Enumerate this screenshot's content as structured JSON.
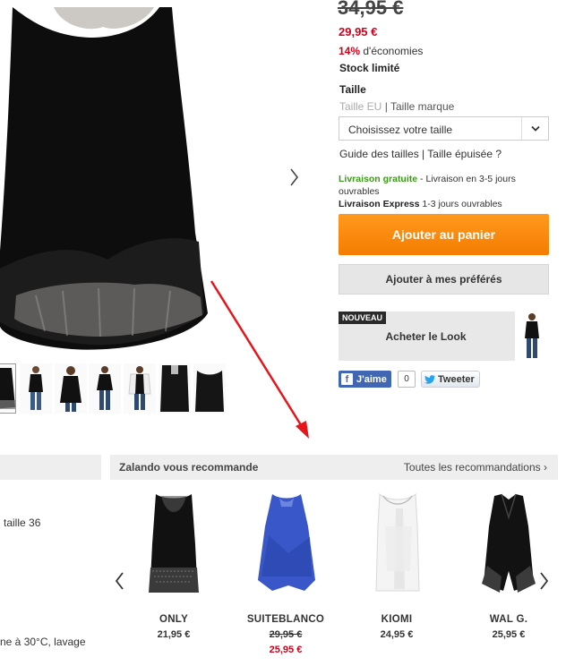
{
  "product": {
    "old_price": "34,95 €",
    "new_price": "29,95 €",
    "savings_pct": "14%",
    "savings_text": " d'économies",
    "stock": "Stock limité",
    "size_label": "Taille",
    "size_system_eu": "Taille EU",
    "size_separator": " | ",
    "size_system_brand": "Taille marque",
    "size_select_placeholder": "Choisissez votre taille",
    "size_guide": "Guide des tailles",
    "size_sep2": " | ",
    "size_sold_out": "Taille épuisée ?",
    "shipping_free_label": "Livraison gratuite",
    "shipping_free_text": " - Livraison en 3-5 jours ouvrables",
    "shipping_express_label": "Livraison Express",
    "shipping_express_text": " 1-3 jours ouvrables",
    "add_to_cart": "Ajouter au panier",
    "add_to_favorites": "Ajouter à mes préférés",
    "look_badge": "NOUVEAU",
    "look_label": "Acheter le Look"
  },
  "social": {
    "like_label": "J'aime",
    "like_count": "0",
    "tweet_label": "Tweeter"
  },
  "left_panel": {
    "text_1": "taille 36",
    "text_2": "ne à 30°C, lavage"
  },
  "recommendations": {
    "title": "Zalando vous recommande",
    "see_all": "Toutes les recommandations",
    "items": [
      {
        "brand": "ONLY",
        "price": "21,95 €"
      },
      {
        "brand": "SUITEBLANCO",
        "old_price": "29,95 €",
        "price": "25,95 €"
      },
      {
        "brand": "KIOMI",
        "price": "24,95 €"
      },
      {
        "brand": "WAL G.",
        "price": "25,95 €"
      }
    ]
  },
  "colors": {
    "accent_orange": "#f57c00",
    "sale_red": "#d0021b",
    "free_shipping_green": "#3a9a16",
    "facebook_blue": "#4267b2",
    "annotation_arrow": "#e8141b"
  }
}
